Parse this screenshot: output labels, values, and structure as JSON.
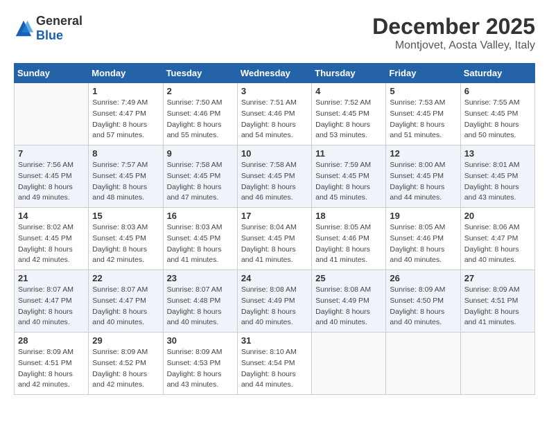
{
  "header": {
    "logo_general": "General",
    "logo_blue": "Blue",
    "month_title": "December 2025",
    "location": "Montjovet, Aosta Valley, Italy"
  },
  "days_of_week": [
    "Sunday",
    "Monday",
    "Tuesday",
    "Wednesday",
    "Thursday",
    "Friday",
    "Saturday"
  ],
  "weeks": [
    [
      {
        "day": "",
        "info": ""
      },
      {
        "day": "1",
        "info": "Sunrise: 7:49 AM\nSunset: 4:47 PM\nDaylight: 8 hours\nand 57 minutes."
      },
      {
        "day": "2",
        "info": "Sunrise: 7:50 AM\nSunset: 4:46 PM\nDaylight: 8 hours\nand 55 minutes."
      },
      {
        "day": "3",
        "info": "Sunrise: 7:51 AM\nSunset: 4:46 PM\nDaylight: 8 hours\nand 54 minutes."
      },
      {
        "day": "4",
        "info": "Sunrise: 7:52 AM\nSunset: 4:45 PM\nDaylight: 8 hours\nand 53 minutes."
      },
      {
        "day": "5",
        "info": "Sunrise: 7:53 AM\nSunset: 4:45 PM\nDaylight: 8 hours\nand 51 minutes."
      },
      {
        "day": "6",
        "info": "Sunrise: 7:55 AM\nSunset: 4:45 PM\nDaylight: 8 hours\nand 50 minutes."
      }
    ],
    [
      {
        "day": "7",
        "info": "Sunrise: 7:56 AM\nSunset: 4:45 PM\nDaylight: 8 hours\nand 49 minutes."
      },
      {
        "day": "8",
        "info": "Sunrise: 7:57 AM\nSunset: 4:45 PM\nDaylight: 8 hours\nand 48 minutes."
      },
      {
        "day": "9",
        "info": "Sunrise: 7:58 AM\nSunset: 4:45 PM\nDaylight: 8 hours\nand 47 minutes."
      },
      {
        "day": "10",
        "info": "Sunrise: 7:58 AM\nSunset: 4:45 PM\nDaylight: 8 hours\nand 46 minutes."
      },
      {
        "day": "11",
        "info": "Sunrise: 7:59 AM\nSunset: 4:45 PM\nDaylight: 8 hours\nand 45 minutes."
      },
      {
        "day": "12",
        "info": "Sunrise: 8:00 AM\nSunset: 4:45 PM\nDaylight: 8 hours\nand 44 minutes."
      },
      {
        "day": "13",
        "info": "Sunrise: 8:01 AM\nSunset: 4:45 PM\nDaylight: 8 hours\nand 43 minutes."
      }
    ],
    [
      {
        "day": "14",
        "info": "Sunrise: 8:02 AM\nSunset: 4:45 PM\nDaylight: 8 hours\nand 42 minutes."
      },
      {
        "day": "15",
        "info": "Sunrise: 8:03 AM\nSunset: 4:45 PM\nDaylight: 8 hours\nand 42 minutes."
      },
      {
        "day": "16",
        "info": "Sunrise: 8:03 AM\nSunset: 4:45 PM\nDaylight: 8 hours\nand 41 minutes."
      },
      {
        "day": "17",
        "info": "Sunrise: 8:04 AM\nSunset: 4:45 PM\nDaylight: 8 hours\nand 41 minutes."
      },
      {
        "day": "18",
        "info": "Sunrise: 8:05 AM\nSunset: 4:46 PM\nDaylight: 8 hours\nand 41 minutes."
      },
      {
        "day": "19",
        "info": "Sunrise: 8:05 AM\nSunset: 4:46 PM\nDaylight: 8 hours\nand 40 minutes."
      },
      {
        "day": "20",
        "info": "Sunrise: 8:06 AM\nSunset: 4:47 PM\nDaylight: 8 hours\nand 40 minutes."
      }
    ],
    [
      {
        "day": "21",
        "info": "Sunrise: 8:07 AM\nSunset: 4:47 PM\nDaylight: 8 hours\nand 40 minutes."
      },
      {
        "day": "22",
        "info": "Sunrise: 8:07 AM\nSunset: 4:47 PM\nDaylight: 8 hours\nand 40 minutes."
      },
      {
        "day": "23",
        "info": "Sunrise: 8:07 AM\nSunset: 4:48 PM\nDaylight: 8 hours\nand 40 minutes."
      },
      {
        "day": "24",
        "info": "Sunrise: 8:08 AM\nSunset: 4:49 PM\nDaylight: 8 hours\nand 40 minutes."
      },
      {
        "day": "25",
        "info": "Sunrise: 8:08 AM\nSunset: 4:49 PM\nDaylight: 8 hours\nand 40 minutes."
      },
      {
        "day": "26",
        "info": "Sunrise: 8:09 AM\nSunset: 4:50 PM\nDaylight: 8 hours\nand 40 minutes."
      },
      {
        "day": "27",
        "info": "Sunrise: 8:09 AM\nSunset: 4:51 PM\nDaylight: 8 hours\nand 41 minutes."
      }
    ],
    [
      {
        "day": "28",
        "info": "Sunrise: 8:09 AM\nSunset: 4:51 PM\nDaylight: 8 hours\nand 42 minutes."
      },
      {
        "day": "29",
        "info": "Sunrise: 8:09 AM\nSunset: 4:52 PM\nDaylight: 8 hours\nand 42 minutes."
      },
      {
        "day": "30",
        "info": "Sunrise: 8:09 AM\nSunset: 4:53 PM\nDaylight: 8 hours\nand 43 minutes."
      },
      {
        "day": "31",
        "info": "Sunrise: 8:10 AM\nSunset: 4:54 PM\nDaylight: 8 hours\nand 44 minutes."
      },
      {
        "day": "",
        "info": ""
      },
      {
        "day": "",
        "info": ""
      },
      {
        "day": "",
        "info": ""
      }
    ]
  ]
}
